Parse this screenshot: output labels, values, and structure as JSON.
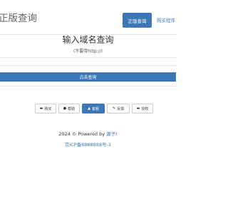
{
  "header": {
    "brand": "正版查询",
    "primary_button": "正版查询",
    "nav_link": "购买程序"
  },
  "main": {
    "title": "输入域名查询",
    "subtitle": "(不要带http://)",
    "input_value": "",
    "input_placeholder": "",
    "query_button": "点击查询"
  },
  "toolbar": {
    "items": [
      {
        "label": "购买",
        "icon": "buy-icon"
      },
      {
        "label": "帮助",
        "icon": "help-icon"
      },
      {
        "label": "客服",
        "icon": "user-icon",
        "active": true
      },
      {
        "label": "反馈",
        "icon": "edit-icon"
      },
      {
        "label": "授权",
        "icon": "auth-icon"
      }
    ]
  },
  "footer": {
    "copyright": "2024 © Powered by ",
    "powered_name": "源子!",
    "icp": "京ICP备8888888号-1"
  },
  "colors": {
    "accent": "#3c78b5",
    "border": "#e1e1e1"
  }
}
